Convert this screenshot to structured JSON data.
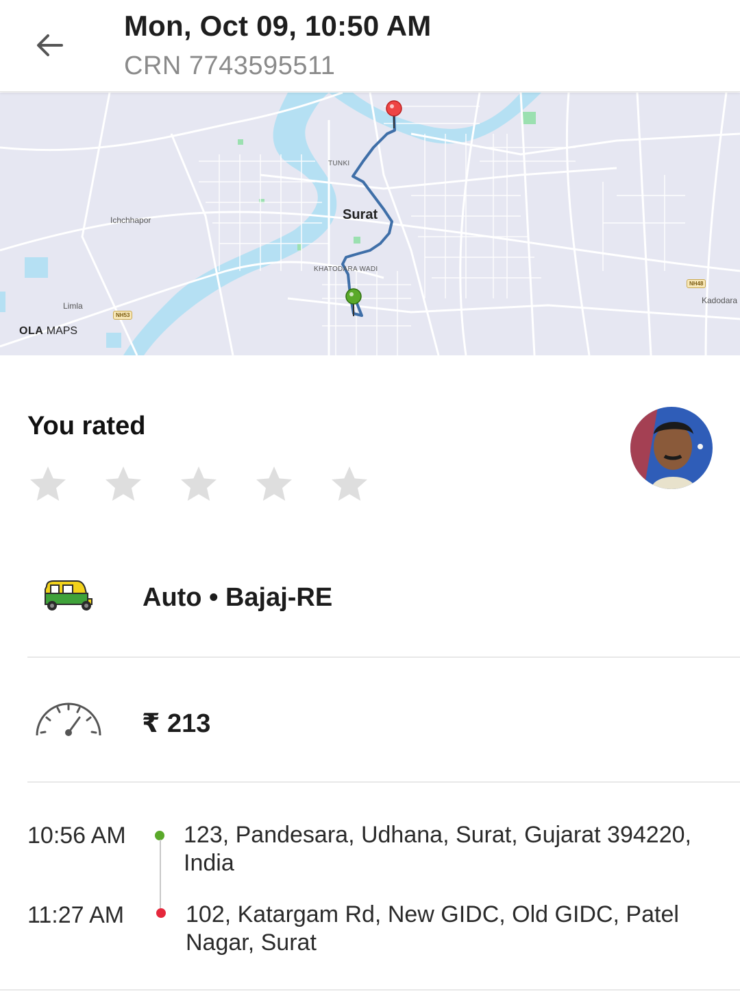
{
  "header": {
    "datetime": "Mon, Oct 09, 10:50 AM",
    "crn": "CRN 7743595511"
  },
  "map": {
    "labels": {
      "city": "Surat",
      "tunki": "TUNKI",
      "ichchhapor": "Ichchhapor",
      "khatodara": "KHATODARA WADI",
      "limla": "Limla",
      "kadodara": "Kadodara",
      "nh53": "NH53",
      "nh48": "NH48"
    },
    "logo_bold": "OLA",
    "logo_text": "MAPS",
    "pickup_pin_color": "#5aa92a",
    "drop_pin_color": "#ee4444",
    "route_color": "#3f6fa8"
  },
  "rating": {
    "title": "You rated",
    "stars_total": 5,
    "stars_filled": 0
  },
  "vehicle": {
    "icon": "auto-rickshaw-icon",
    "label": "Auto • Bajaj-RE"
  },
  "fare": {
    "icon": "speedometer-icon",
    "amount": "₹ 213"
  },
  "trip": {
    "pickup": {
      "time": "10:56 AM",
      "address": "123, Pandesara, Udhana, Surat, Gujarat 394220, India",
      "dot_color": "#5aa92a"
    },
    "drop": {
      "time": "11:27 AM",
      "address": "102, Katargam Rd, New GIDC, Old GIDC, Patel Nagar, Surat",
      "dot_color": "#e5283c"
    }
  }
}
